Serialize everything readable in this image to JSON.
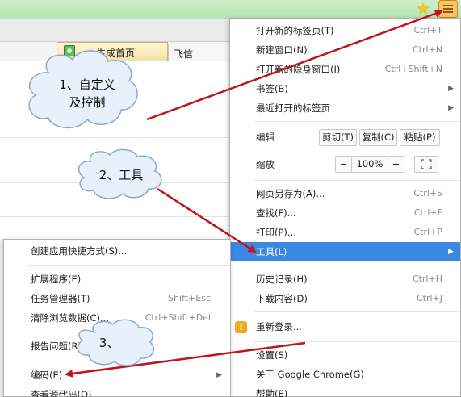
{
  "browser": {
    "tabs": [
      {
        "label": "生成首页"
      },
      {
        "label": "飞信"
      }
    ],
    "icons": {
      "bookmark_star": "star-icon",
      "menu": "hamburger-menu-icon"
    }
  },
  "main_menu": {
    "items": {
      "new_tab": {
        "label": "打开新的标签页(T)",
        "shortcut": "Ctrl+T"
      },
      "new_window": {
        "label": "新建窗口(N)",
        "shortcut": "Ctrl+N"
      },
      "incognito": {
        "label": "打开新的隐身窗口(I)",
        "shortcut": "Ctrl+Shift+N"
      },
      "bookmarks": {
        "label": "书签(B)"
      },
      "recent_tabs": {
        "label": "最近打开的标签页"
      },
      "edit": {
        "label": "编辑",
        "cut": "剪切(T)",
        "copy": "复制(C)",
        "paste": "粘贴(P)"
      },
      "zoom": {
        "label": "缩放",
        "minus": "−",
        "value": "100%",
        "plus": "+"
      },
      "save_as": {
        "label": "网页另存为(A)...",
        "shortcut": "Ctrl+S"
      },
      "find": {
        "label": "查找(F)...",
        "shortcut": "Ctrl+F"
      },
      "print": {
        "label": "打印(P)...",
        "shortcut": "Ctrl+P"
      },
      "tools": {
        "label": "工具(L)"
      },
      "history": {
        "label": "历史记录(H)",
        "shortcut": "Ctrl+H"
      },
      "downloads": {
        "label": "下载内容(D)",
        "shortcut": "Ctrl+J"
      },
      "relogin": {
        "label": "重新登录..."
      },
      "settings": {
        "label": "设置(S)"
      },
      "about": {
        "label": "关于 Google Chrome(G)"
      },
      "help": {
        "label": "帮助(E)"
      }
    }
  },
  "tools_submenu": {
    "items": {
      "create_shortcut": {
        "label": "创建应用快捷方式(S)..."
      },
      "extensions": {
        "label": "扩展程序(E)"
      },
      "task_manager": {
        "label": "任务管理器(T)",
        "shortcut": "Shift+Esc"
      },
      "clear_data": {
        "label": "清除浏览数据(C)...",
        "shortcut": "Ctrl+Shift+Del"
      },
      "report_issue": {
        "label": "报告问题(R)..."
      },
      "encoding": {
        "label": "编码(E)"
      },
      "view_source": {
        "label": "查看源代码(O)"
      }
    }
  },
  "annotations": {
    "step1_line1": "1、自定义",
    "step1_line2": "及控制",
    "step2": "2、工具",
    "step3": "3、"
  },
  "colors": {
    "selected_item": "#3b87e4",
    "arrow": "#c0141b",
    "cloud_fill": "#e7f0fb",
    "cloud_stroke": "#8aa8cc",
    "toolbar_green": "#c3e8c0"
  }
}
